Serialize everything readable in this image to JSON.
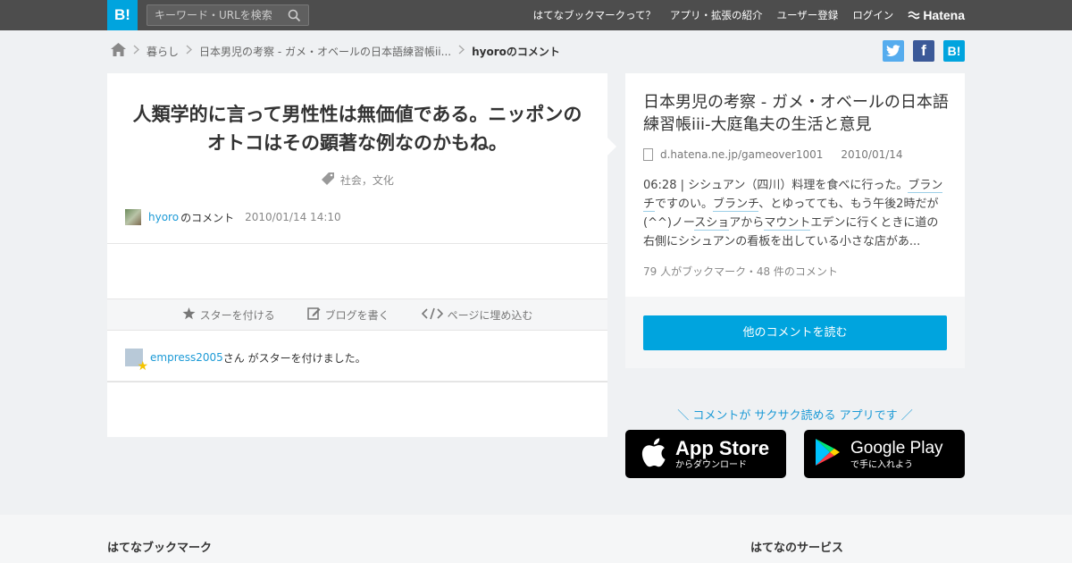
{
  "header": {
    "logo": "B!",
    "search_placeholder": "キーワード・URLを検索",
    "nav": [
      "はてなブックマークって？",
      "アプリ・拡張の紹介",
      "ユーザー登録",
      "ログイン"
    ],
    "brand": "Hatena"
  },
  "breadcrumb": {
    "items": [
      "暮らし",
      "日本男児の考察 - ガメ・オベールの日本語練習帳ii..."
    ],
    "current": "hyoroのコメント"
  },
  "share": {
    "b": "B!"
  },
  "comment": {
    "title": "人類学的に言って男性性は無価値である。ニッポンのオトコはその顕著な例なのかもね。",
    "tags": "社会，文化",
    "user": "hyoro",
    "user_suffix": "のコメント",
    "date": "2010/01/14 14:10"
  },
  "actions": {
    "star": "スターを付ける",
    "blog": "ブログを書く",
    "embed": "ページに埋め込む"
  },
  "star_notice": {
    "user": "empress2005",
    "text": "さん がスターを付けました。"
  },
  "entry": {
    "title": "日本男児の考察 - ガメ・オベールの日本語練習帳iii-大庭亀夫の生活と意見",
    "domain": "d.hatena.ne.jp/gameover1001",
    "date": "2010/01/14",
    "summary_parts": [
      "06:28 | シシュアン（四川）料理を食べに行った。",
      "ブランチ",
      "ですのい。",
      "ブランチ",
      "、とゆってても、もう午後2時だが(^^)ノー",
      "スショ",
      "アから",
      "マウント",
      "エデンに行くときに道の右側にシシュアンの看板を出している小さな店があ..."
    ],
    "counts": "79 人がブックマーク・48 件のコメント",
    "read_button": "他のコメントを読む"
  },
  "apps": {
    "tagline": "＼ コメントが サクサク読める アプリです ／",
    "appstore_big": "App Store",
    "appstore_small": "からダウンロード",
    "gplay_big": "Google Play",
    "gplay_small": "で手に入れよう"
  },
  "footer": {
    "left": "はてなブックマーク",
    "right": "はてなのサービス"
  },
  "colors": {
    "accent": "#00a4de",
    "link": "#1c9ad6",
    "topbar": "#4d4d4d",
    "twitter": "#55acee",
    "facebook": "#3b5998"
  }
}
